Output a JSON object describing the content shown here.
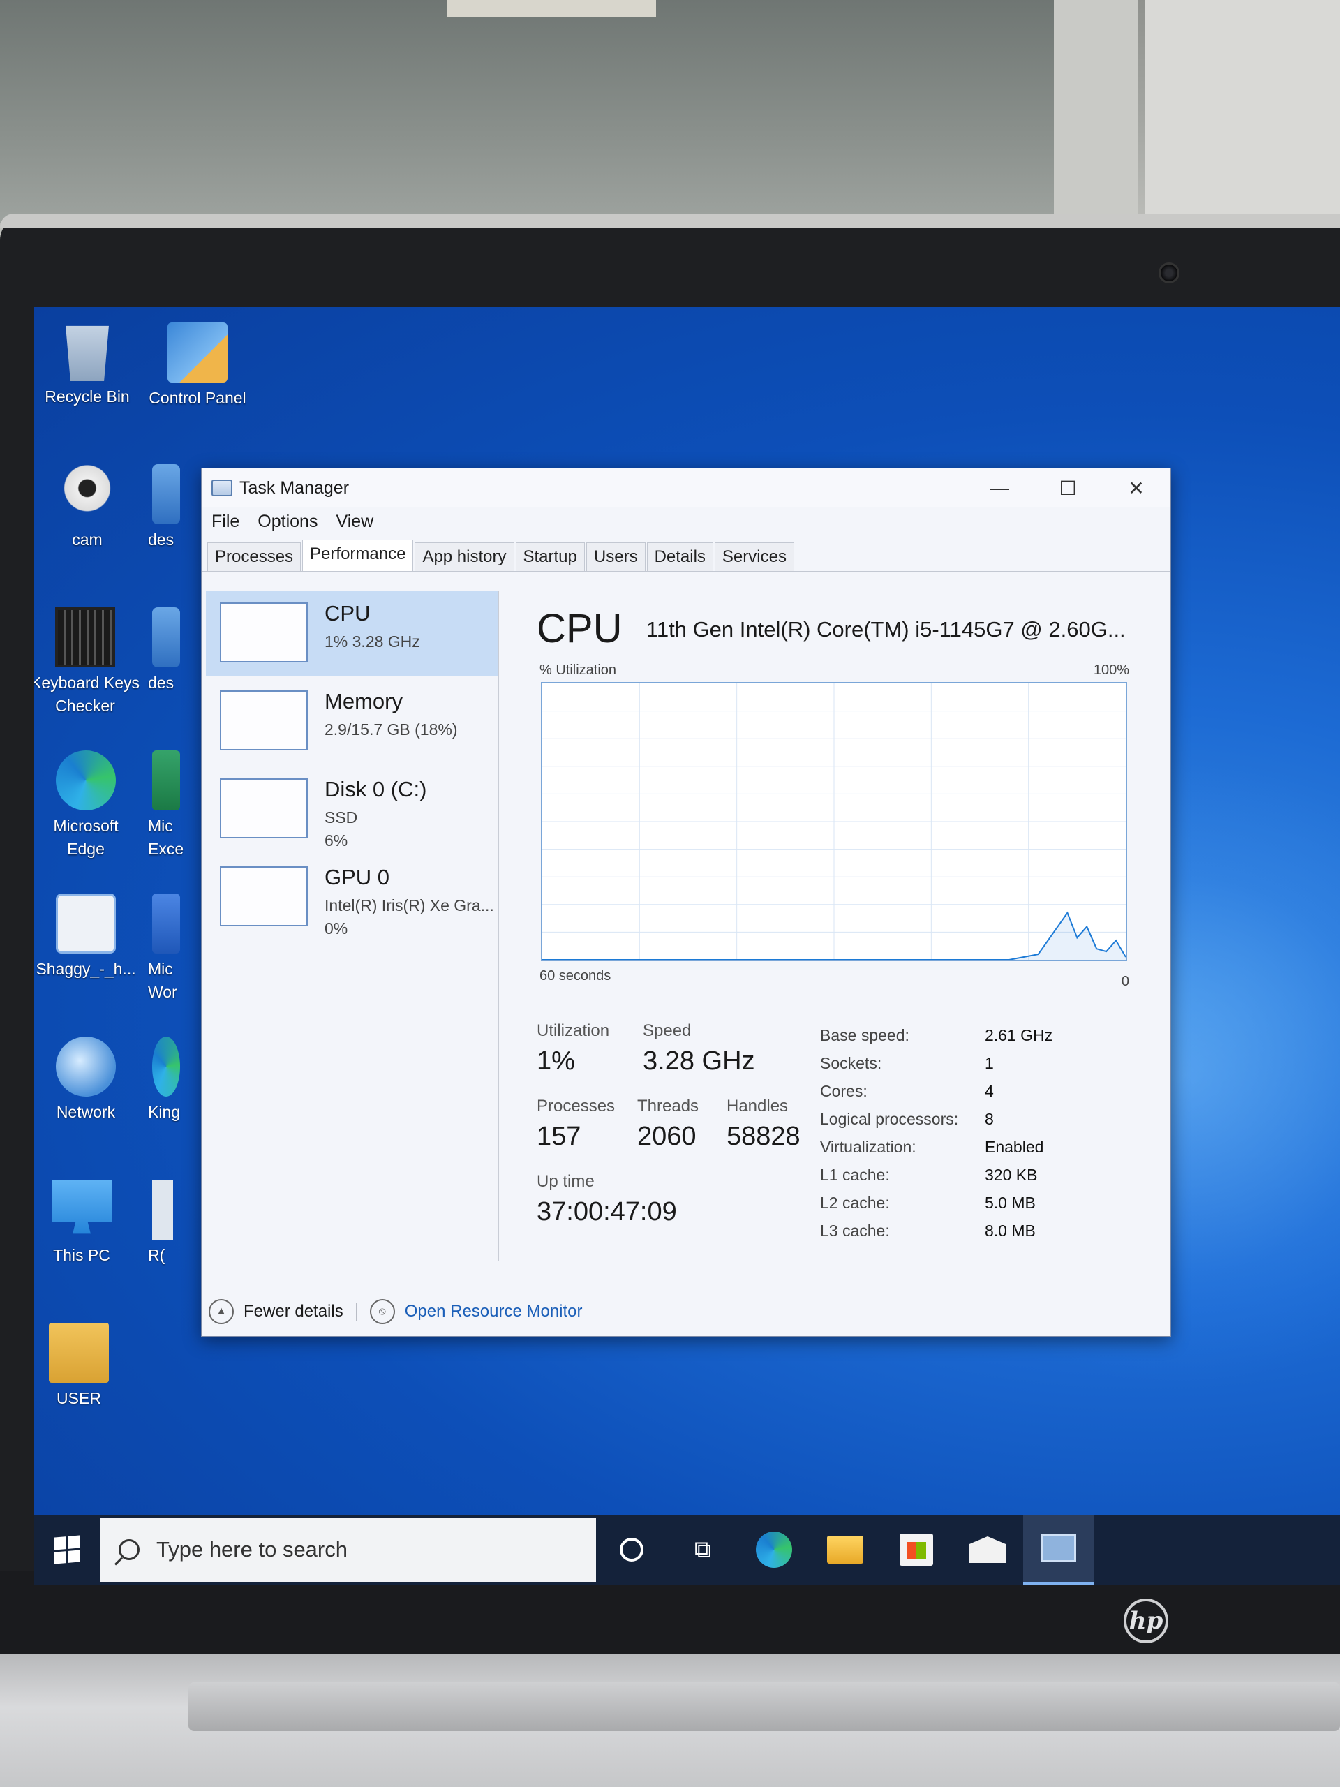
{
  "desktop": {
    "icons": [
      {
        "label": "Recycle Bin"
      },
      {
        "label": "Control Panel"
      },
      {
        "label": "cam"
      },
      {
        "label": "des"
      },
      {
        "label": "Keyboard Keys Checker"
      },
      {
        "label": "des"
      },
      {
        "label": "Microsoft Edge"
      },
      {
        "label": "Mic Exce"
      },
      {
        "label": "Shaggy_-_h..."
      },
      {
        "label": "Mic Wor"
      },
      {
        "label": "Network"
      },
      {
        "label": "King"
      },
      {
        "label": "This PC"
      },
      {
        "label": "R("
      },
      {
        "label": "USER"
      }
    ]
  },
  "taskmanager": {
    "title": "Task Manager",
    "minimize": "—",
    "maximize": "☐",
    "close": "✕",
    "menu": [
      "File",
      "Options",
      "View"
    ],
    "tabs": [
      "Processes",
      "Performance",
      "App history",
      "Startup",
      "Users",
      "Details",
      "Services"
    ],
    "active_tab": "Performance",
    "sidebar": [
      {
        "name": "CPU",
        "sub1": "1%  3.28 GHz",
        "sub2": ""
      },
      {
        "name": "Memory",
        "sub1": "2.9/15.7 GB (18%)",
        "sub2": ""
      },
      {
        "name": "Disk 0 (C:)",
        "sub1": "SSD",
        "sub2": "6%"
      },
      {
        "name": "GPU 0",
        "sub1": "Intel(R) Iris(R) Xe Gra...",
        "sub2": "0%"
      }
    ],
    "main": {
      "heading": "CPU",
      "model": "11th Gen Intel(R) Core(TM) i5-1145G7 @ 2.60G...",
      "axis_left_top": "% Utilization",
      "axis_right_top": "100%",
      "axis_left_bottom": "60 seconds",
      "axis_right_bottom": "0",
      "stats": {
        "utilization": {
          "label": "Utilization",
          "value": "1%"
        },
        "speed": {
          "label": "Speed",
          "value": "3.28 GHz"
        },
        "processes": {
          "label": "Processes",
          "value": "157"
        },
        "threads": {
          "label": "Threads",
          "value": "2060"
        },
        "handles": {
          "label": "Handles",
          "value": "58828"
        },
        "uptime": {
          "label": "Up time",
          "value": "37:00:47:09"
        }
      },
      "specs": [
        {
          "k": "Base speed:",
          "v": "2.61 GHz"
        },
        {
          "k": "Sockets:",
          "v": "1"
        },
        {
          "k": "Cores:",
          "v": "4"
        },
        {
          "k": "Logical processors:",
          "v": "8"
        },
        {
          "k": "Virtualization:",
          "v": "Enabled"
        },
        {
          "k": "L1 cache:",
          "v": "320 KB"
        },
        {
          "k": "L2 cache:",
          "v": "5.0 MB"
        },
        {
          "k": "L3 cache:",
          "v": "8.0 MB"
        }
      ]
    },
    "footer": {
      "fewer_details": "Fewer details",
      "open_resource_monitor": "Open Resource Monitor"
    }
  },
  "chart_data": {
    "type": "line",
    "x": [
      60,
      57,
      54,
      51,
      48,
      45,
      42,
      39,
      36,
      33,
      30,
      27,
      24,
      21,
      18,
      15,
      12,
      9,
      6,
      5,
      4,
      3,
      2,
      1,
      0
    ],
    "values": [
      0,
      0,
      0,
      0,
      0,
      0,
      0,
      0,
      0,
      0,
      0,
      0,
      0,
      0,
      0,
      0,
      0,
      2,
      17,
      8,
      12,
      4,
      3,
      7,
      1
    ],
    "xlabel": "60 seconds",
    "ylabel": "% Utilization",
    "ylim": [
      0,
      100
    ],
    "xlim": [
      60,
      0
    ],
    "grid": true,
    "line_color": "#1c7ad6"
  },
  "taskbar": {
    "search_placeholder": "Type here to search"
  },
  "brand": "hp"
}
